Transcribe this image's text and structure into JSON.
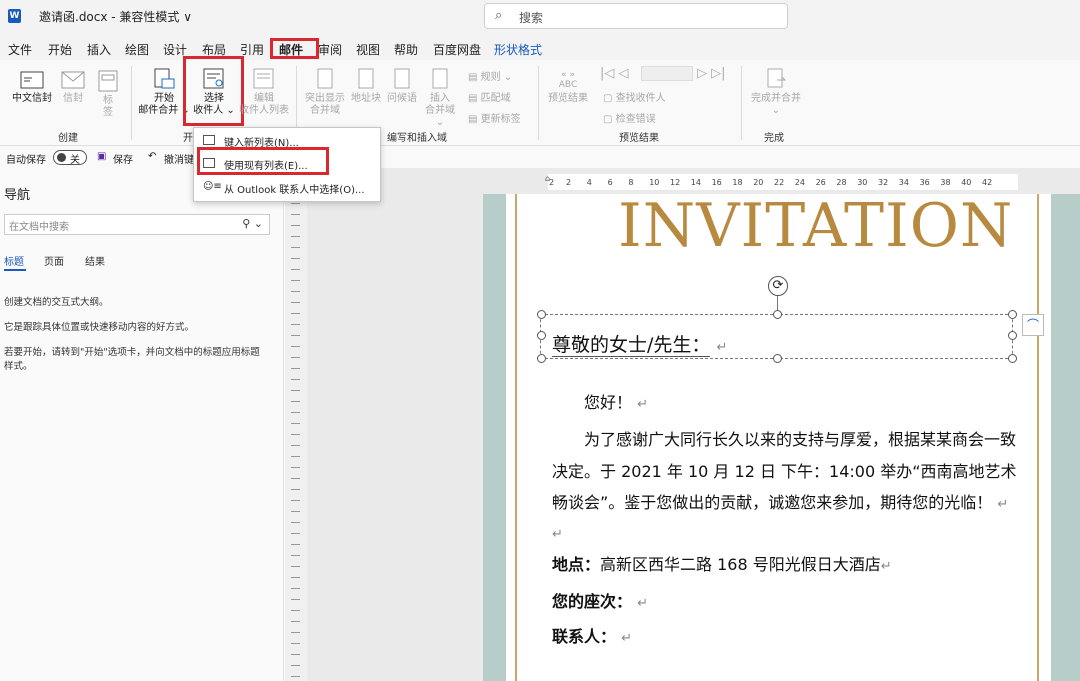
{
  "window": {
    "app_icon": "W",
    "doc_title": "邀请函.docx  -  兼容性模式 ∨",
    "search_placeholder": "搜索"
  },
  "menu_tabs": [
    "文件",
    "开始",
    "插入",
    "绘图",
    "设计",
    "布局",
    "引用",
    "邮件",
    "审阅",
    "视图",
    "帮助",
    "百度网盘",
    "形状格式"
  ],
  "ribbon": {
    "create_group": "创建",
    "buttons": {
      "chinese_envelope": "中文信封",
      "envelope": "信封",
      "labels": "标签",
      "start_merge_1": "开始",
      "start_merge_2": "邮件合并 ⌄",
      "select_recipients_1": "选择",
      "select_recipients_2": "收件人 ⌄",
      "edit_list_1": "编辑",
      "edit_list_2": "收件人列表",
      "highlight_1": "突出显示",
      "highlight_2": "合并域",
      "address_block": "地址块",
      "greeting": "问候语",
      "insert_field_1": "插入",
      "insert_field_2": "合并域 ⌄",
      "rules": "规则 ⌄",
      "match_fields": "匹配域",
      "update_labels": "更新标签",
      "preview_icon": "ABC",
      "preview_results": "预览结果",
      "find_recipient": "查找收件人",
      "check_errors": "检查错误",
      "finish_merge_1": "完成并合并",
      "finish_merge_2": "⌄"
    },
    "groups": {
      "start": "开",
      "write_insert": "编写和插入域",
      "preview": "预览结果",
      "finish": "完成"
    }
  },
  "qat": {
    "autosave": "自动保存",
    "toggle_state": "关",
    "save": "保存",
    "undo": "撤消键"
  },
  "dropdown": {
    "items": [
      "键入新列表(N)...",
      "使用现有列表(E)...",
      "从 Outlook 联系人中选择(O)..."
    ]
  },
  "nav": {
    "title": "导航",
    "search_placeholder": "在文档中搜索",
    "tabs": [
      "标题",
      "页面",
      "结果"
    ],
    "lines": [
      "创建文档的交互式大纲。",
      "它是跟踪具体位置或快速移动内容的好方式。",
      "若要开始，请转到\"开始\"选项卡，并向文档中的标题应用标题",
      "样式。"
    ]
  },
  "ruler": {
    "numbers": [
      "2",
      "2",
      "4",
      "6",
      "8",
      "10",
      "12",
      "14",
      "16",
      "18",
      "20",
      "22",
      "24",
      "26",
      "28",
      "30",
      "32",
      "34",
      "36",
      "38",
      "40",
      "42"
    ]
  },
  "document": {
    "heading": "INVITATION",
    "greeting": "尊敬的女士/先生：",
    "hello": "您好！",
    "para_1": "为了感谢广大同行长久以来的支持与厚爱，根据某某商会一致",
    "para_2": "决定。于 2021 年 10 月 12 日  下午：14:00 举办“西南高地艺术",
    "para_3": "畅谈会”。鉴于您做出的贡献，诚邀您来参加，期待您的光临！",
    "location_label": "地点：",
    "location_value": "高新区西华二路 168 号阳光假日大酒店",
    "seat_label": "您的座次：",
    "contact_label": "联系人：",
    "para_mark": "↵"
  },
  "colors": {
    "accent": "#185abd",
    "highlight_box": "#d9282f",
    "gold": "#b88a3f",
    "page_bg": "#b7cdc9"
  }
}
